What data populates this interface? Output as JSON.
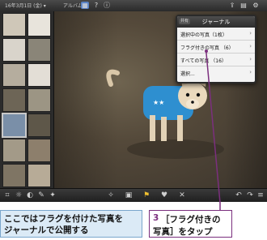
{
  "topbar": {
    "date": "16年3月1日 (金) ▾",
    "album_label": "アルバム",
    "share_label": "ジャーナル"
  },
  "popover": {
    "back_label": "共有",
    "title": "ジャーナル",
    "rows": [
      {
        "label": "選択中の写真（1枚）"
      },
      {
        "label": "フラグ付きの写真 （6）"
      },
      {
        "label": "すべての写真 （16）"
      },
      {
        "label": "選択..."
      }
    ]
  },
  "callouts": {
    "left_text_line1": "ここではフラグを付けた写真を",
    "left_text_line2": "ジャーナルで公開する",
    "step_number": "3",
    "step_line1": "［フラグ付きの",
    "step_line2": "写真］をタップ"
  },
  "colors": {
    "callout_line": "#7b2f7e",
    "left_box_bg": "#dbeaf6",
    "left_box_border": "#7aa6cc"
  },
  "icons": {
    "topbar": [
      "grid-icon",
      "help-icon",
      "info-icon",
      "share-icon",
      "journal-icon"
    ],
    "bottombar": [
      "wand-icon",
      "crop-icon",
      "exposure-icon",
      "color-icon",
      "brush-icon",
      "effects-icon",
      "flag-icon",
      "favorite-icon",
      "hide-icon",
      "undo-icon",
      "share-icon",
      "menu-icon"
    ]
  }
}
